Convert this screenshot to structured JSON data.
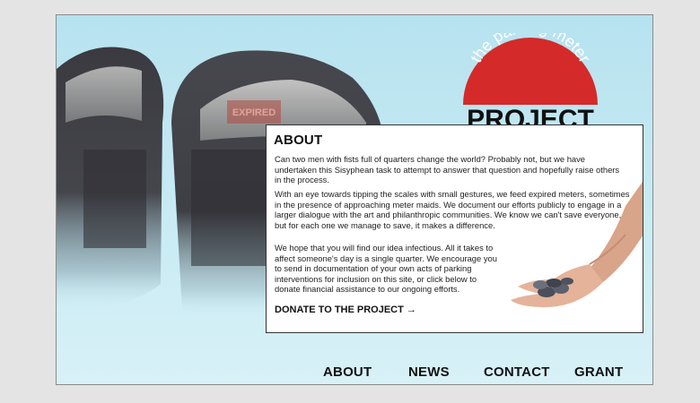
{
  "logo": {
    "arc_text": "the parking meter",
    "word": "PROJECT"
  },
  "meter_display": "EXPIRED",
  "about": {
    "heading": "ABOUT",
    "p1": "Can two men with fists full of quarters change the world? Probably not, but we have undertaken this Sisyphean task to attempt to answer that question and hopefully raise others in the process.",
    "p2": "With an eye towards tipping the scales with small gestures, we feed expired meters, sometimes in the presence of approaching meter maids. We document our efforts publicly to engage in a larger dialogue with the art and philanthropic communities. We know we can't save everyone, but for each one we manage to save, it makes a difference.",
    "p3": "We hope that you will find our idea infectious. All it takes to affect someone's day is a single quarter. We encourage you to send in documentation of your own acts of parking interventions for inclusion on this site, or click below to donate financial assistance to our ongoing efforts.",
    "donate_label": "DONATE TO THE PROJECT →"
  },
  "nav": {
    "about": "ABOUT",
    "news": "NEWS",
    "contact": "CONTACT",
    "grant": "GRANT"
  },
  "colors": {
    "logo_red": "#d42a2a",
    "sky": "#b6e2ef",
    "meter_dark": "#3d3d44"
  },
  "icons": {
    "hand": "hand-holding-coins-illustration",
    "meters": "parking-meters-illustration"
  }
}
